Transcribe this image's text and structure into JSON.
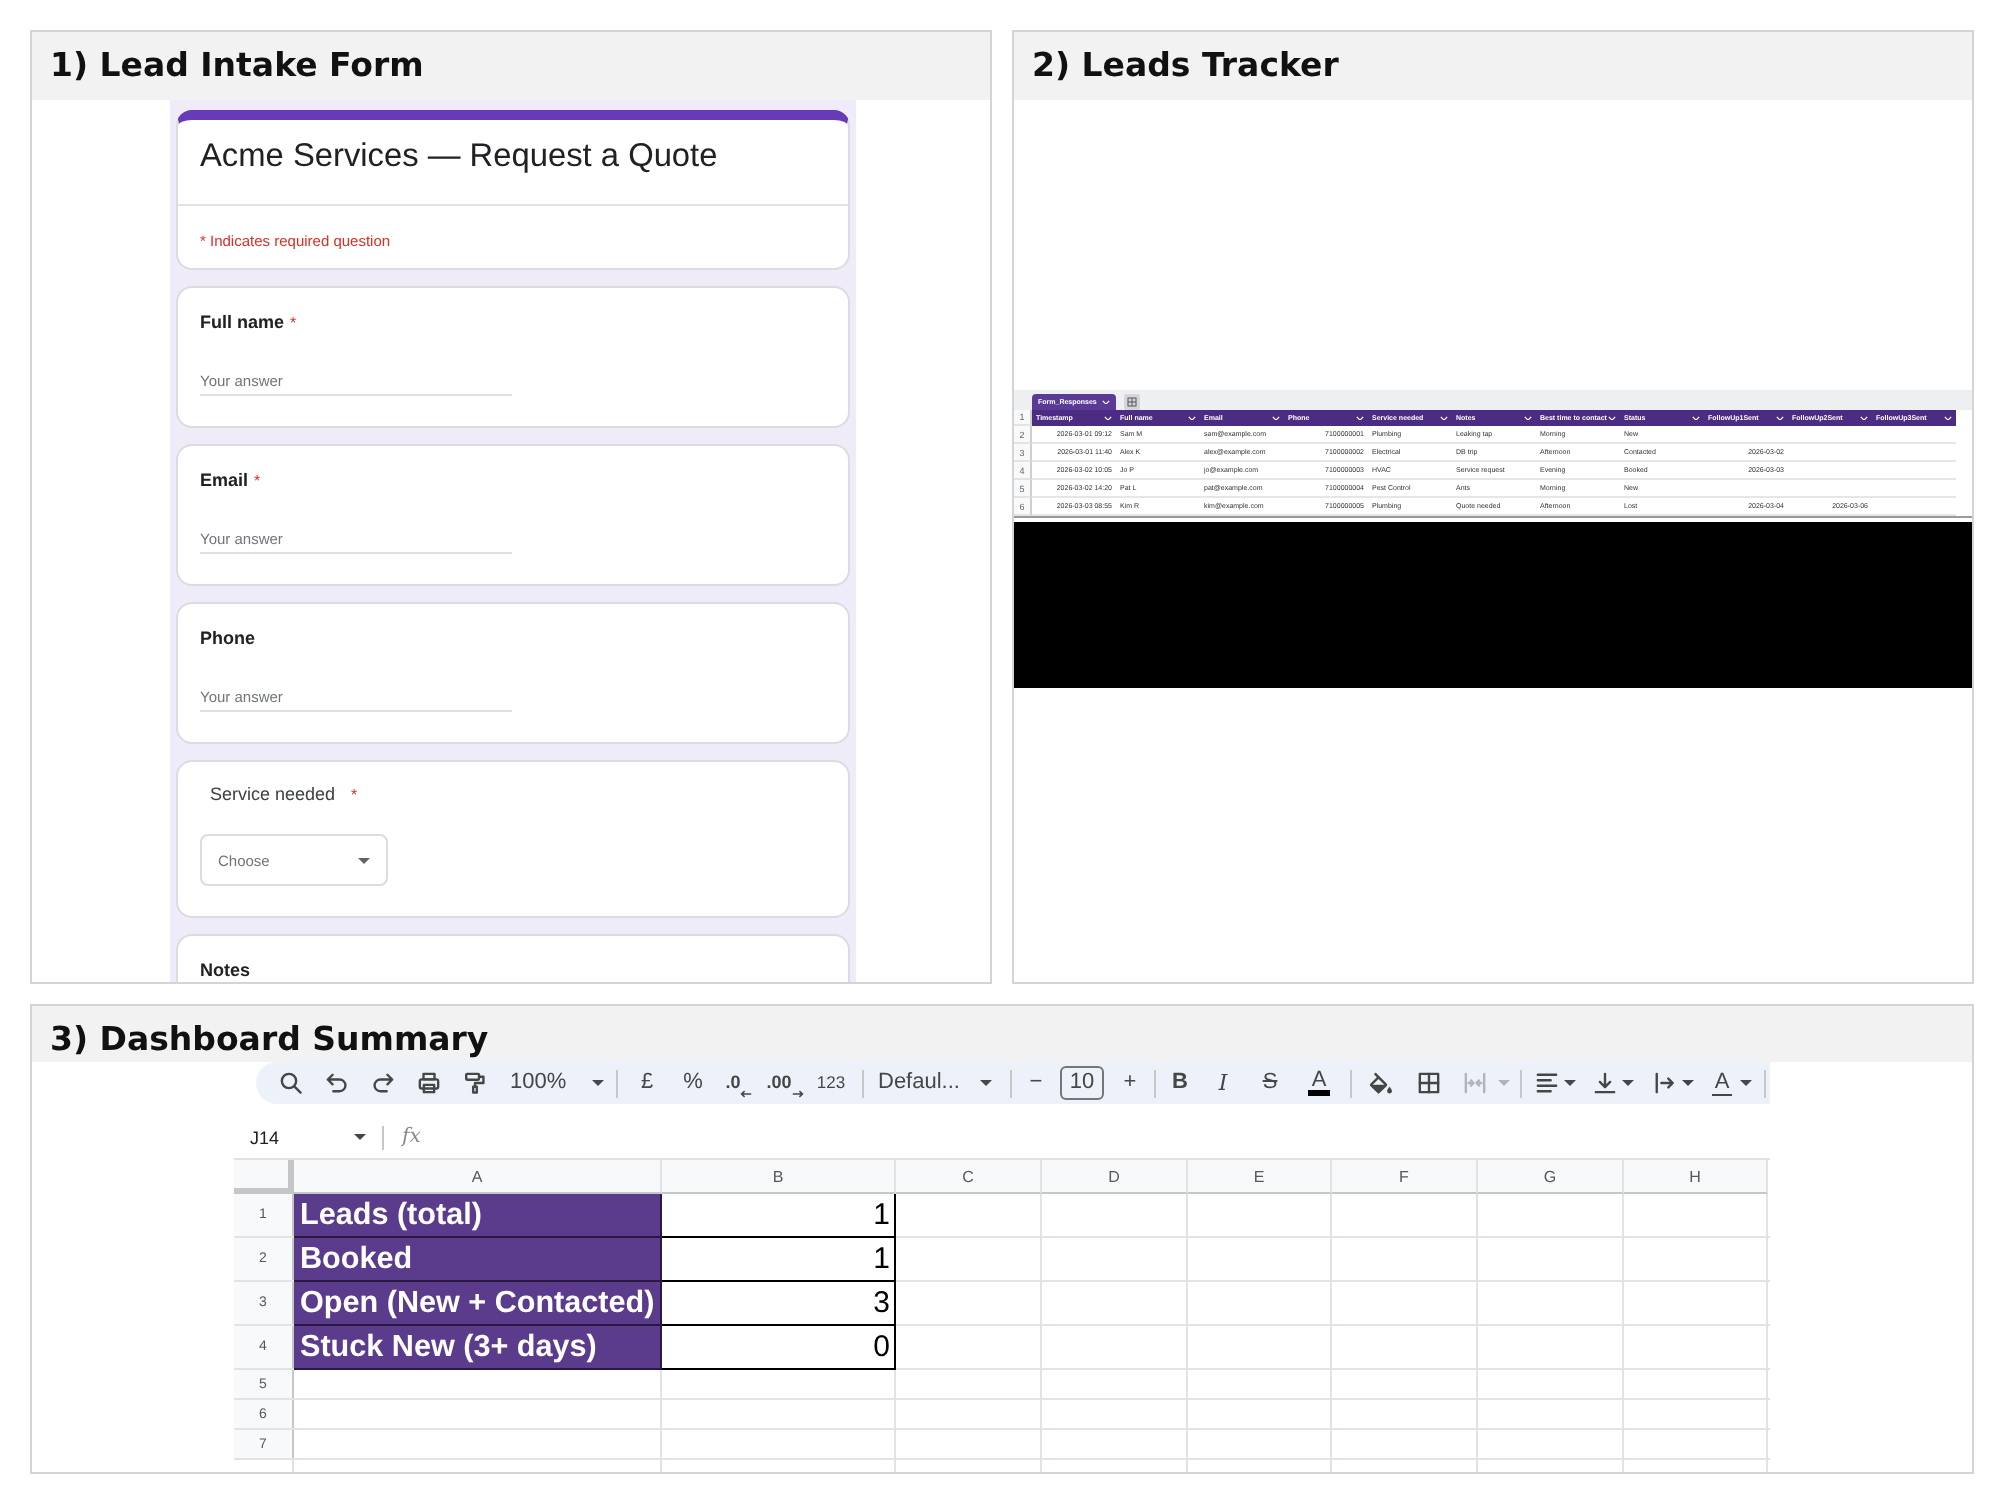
{
  "lead_intake_form": {
    "heading": "1) Lead Intake Form",
    "form": {
      "title": "Acme Services — Request a Quote",
      "required_note": "* Indicates required question",
      "questions": [
        {
          "kind": "short_answer",
          "label": "Full name",
          "required_mark": "*",
          "placeholder": "Your answer"
        },
        {
          "kind": "short_answer",
          "label": "Email",
          "required_mark": "*",
          "placeholder": "Your answer"
        },
        {
          "kind": "short_answer",
          "label": "Phone",
          "placeholder": "Your answer"
        },
        {
          "kind": "dropdown",
          "label": "Service needed",
          "required_mark": "*",
          "placeholder": "Choose"
        },
        {
          "kind": "paragraph",
          "label": "Notes"
        }
      ]
    }
  },
  "leads_tracker": {
    "heading": "2) Leads Tracker",
    "sheet_tab": {
      "label": "Form_Responses",
      "selected": true
    },
    "header_row_number": "1",
    "columns": [
      {
        "label": "Timestamp",
        "kind": "date"
      },
      {
        "label": "Full name",
        "kind": "text"
      },
      {
        "label": "Email",
        "kind": "text"
      },
      {
        "label": "Phone",
        "kind": "number"
      },
      {
        "label": "Service needed",
        "kind": "text"
      },
      {
        "label": "Notes",
        "kind": "text"
      },
      {
        "label": "Best time to contact",
        "kind": "text"
      },
      {
        "label": "Status",
        "kind": "text"
      },
      {
        "label": "FollowUp1Sent",
        "kind": "date"
      },
      {
        "label": "FollowUp2Sent",
        "kind": "date"
      },
      {
        "label": "FollowUp3Sent",
        "kind": "date"
      }
    ],
    "rows": [
      {
        "number": "2",
        "cells": [
          "2026-03-01 09:12",
          "Sam M",
          "sam@example.com",
          "7100000001",
          "Plumbing",
          "Leaking tap",
          "Morning",
          "New"
        ]
      },
      {
        "number": "3",
        "cells": [
          "2026-03-01 11:40",
          "Alex K",
          "alex@example.com",
          "7100000002",
          "Electrical",
          "DB trip",
          "Afternoon",
          "Contacted",
          "2026-03-02"
        ]
      },
      {
        "number": "4",
        "cells": [
          "2026-03-02 10:05",
          "Jo P",
          "jo@example.com",
          "7100000003",
          "HVAC",
          "Service request",
          "Evening",
          "Booked",
          "2026-03-03"
        ]
      },
      {
        "number": "5",
        "cells": [
          "2026-03-02 14:20",
          "Pat L",
          "pat@example.com",
          "7100000004",
          "Pest Control",
          "Ants",
          "Morning",
          "New"
        ]
      },
      {
        "number": "6",
        "cells": [
          "2026-03-03 08:55",
          "Kim R",
          "kim@example.com",
          "7100000005",
          "Plumbing",
          "Quote needed",
          "Afternoon",
          "Lost",
          "2026-03-04",
          "2026-03-06"
        ]
      }
    ]
  },
  "dashboard_summary": {
    "heading": "3) Dashboard Summary",
    "toolbar": {
      "zoom": "100%",
      "currency": "£",
      "percent": "%",
      "decrease_decimal": ".0",
      "increase_decimal": ".00",
      "number_format": "123",
      "font": "Defaul...",
      "decrease_font_size": "−",
      "font_size": "10",
      "increase_font_size": "+",
      "bold": "B",
      "italic": "I",
      "strikethrough": "S",
      "text_color": "A",
      "merge_cells": {
        "disabled": true
      },
      "text_rotation": "A"
    },
    "name_box": "J14",
    "formula_label": "fx",
    "columns": [
      "A",
      "B",
      "C",
      "D",
      "E",
      "F",
      "G",
      "H"
    ],
    "rows": [
      {
        "number": "1",
        "cells": [
          "Leads (total)",
          "1"
        ]
      },
      {
        "number": "2",
        "cells": [
          "Booked",
          "1"
        ]
      },
      {
        "number": "3",
        "cells": [
          "Open (New + Contacted)",
          "3"
        ]
      },
      {
        "number": "4",
        "cells": [
          "Stuck New (3+ days)",
          "0"
        ]
      },
      {
        "number": "5"
      },
      {
        "number": "6"
      },
      {
        "number": "7"
      }
    ]
  }
}
